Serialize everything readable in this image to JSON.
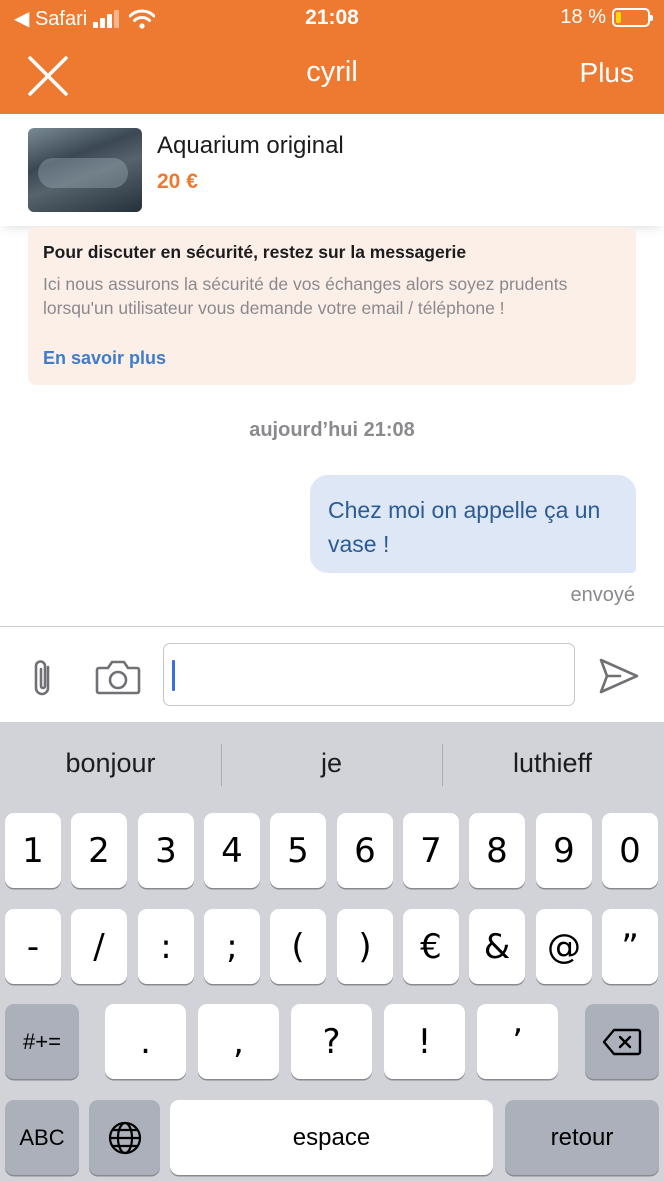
{
  "status_bar": {
    "back_app": "◀ Safari",
    "time": "21:08",
    "battery_percent": "18 %",
    "battery_level": 0.18
  },
  "header": {
    "title": "cyril",
    "more_label": "Plus",
    "close_icon": "close-icon"
  },
  "product": {
    "name": "Aquarium original",
    "price": "20 €"
  },
  "notice": {
    "title": "Pour discuter en sécurité, restez sur la messagerie",
    "body": "Ici nous assurons la sécurité de vos échanges alors soyez prudents lorsqu'un utilisateur vous demande votre email / téléphone !",
    "link": "En savoir plus"
  },
  "conversation": {
    "timestamp": "aujourd’hui 21:08",
    "messages": [
      {
        "text": "Chez moi on appelle ça un vase !",
        "status": "envoyé"
      }
    ]
  },
  "composer": {
    "value": "",
    "attach_icon": "paperclip-icon",
    "camera_icon": "camera-icon",
    "send_icon": "send-icon"
  },
  "keyboard": {
    "suggestions": [
      "bonjour",
      "je",
      "luthieff"
    ],
    "row1": [
      "1",
      "2",
      "3",
      "4",
      "5",
      "6",
      "7",
      "8",
      "9",
      "0"
    ],
    "row2": [
      "-",
      "/",
      ":",
      ";",
      "(",
      ")",
      "€",
      "&",
      "@",
      "”"
    ],
    "row3": [
      "#+=",
      ".",
      ",",
      "?",
      "!",
      "’"
    ],
    "abc": "ABC",
    "space": "espace",
    "return": "retour",
    "globe_icon": "globe-icon",
    "delete_icon": "delete-icon"
  },
  "colors": {
    "brand": "#ee7a31",
    "link": "#3f7dcc",
    "bubble": "#dde7f5"
  }
}
